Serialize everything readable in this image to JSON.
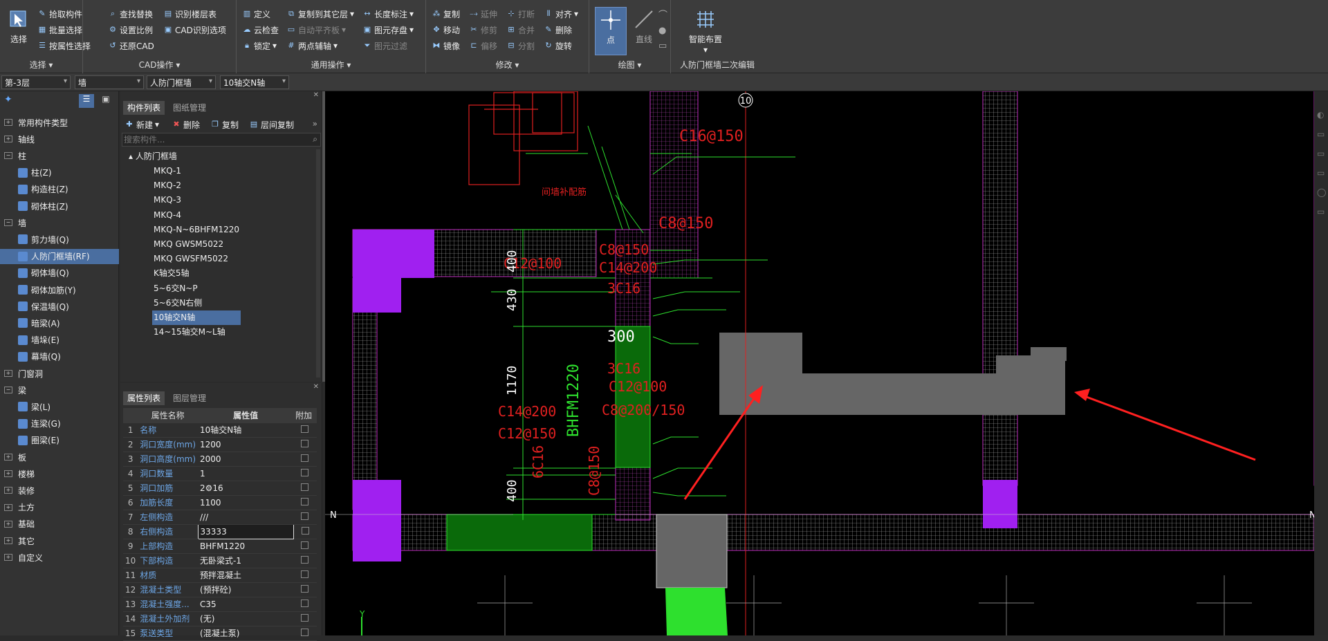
{
  "ribbon": {
    "select_label": "选择",
    "pick_component": "拾取构件",
    "batch_select": "批量选择",
    "select_by_attr": "按属性选择",
    "select_group": "选择",
    "find_replace": "查找替换",
    "set_scale": "设置比例",
    "restore_cad": "还原CAD",
    "identify_floor_table": "识别楼层表",
    "cad_identify_options": "CAD识别选项",
    "cad_ops_group": "CAD操作",
    "define": "定义",
    "cloud_check": "云检查",
    "lock": "锁定",
    "copy_to_other_floor": "复制到其它层",
    "auto_flat_slab": "自动平齐板",
    "two_point_axis": "两点辅轴",
    "length_annotation": "长度标注",
    "element_save": "图元存盘",
    "element_filter": "图元过滤",
    "general_ops_group": "通用操作",
    "copy": "复制",
    "move": "移动",
    "mirror": "镜像",
    "extend": "延伸",
    "trim": "修剪",
    "offset": "偏移",
    "break": "打断",
    "merge": "合并",
    "split": "分割",
    "align": "对齐",
    "delete": "删除",
    "rotate": "旋转",
    "modify_group": "修改",
    "point": "点",
    "line": "直线",
    "draw_group": "绘图",
    "smart_layout": "智能布置",
    "frame_wall_edit_group": "人防门框墙二次编辑"
  },
  "selector_bar": {
    "floor": "第-3层",
    "category": "墙",
    "type": "人防门框墙",
    "instance": "10轴交N轴"
  },
  "tree": {
    "items": [
      {
        "label": "常用构件类型",
        "kind": "group"
      },
      {
        "label": "轴线",
        "kind": "group"
      },
      {
        "label": "柱",
        "kind": "group-open"
      },
      {
        "label": "柱(Z)",
        "kind": "child"
      },
      {
        "label": "构造柱(Z)",
        "kind": "child"
      },
      {
        "label": "砌体柱(Z)",
        "kind": "child"
      },
      {
        "label": "墙",
        "kind": "group-open"
      },
      {
        "label": "剪力墙(Q)",
        "kind": "child"
      },
      {
        "label": "人防门框墙(RF)",
        "kind": "child-selected"
      },
      {
        "label": "砌体墙(Q)",
        "kind": "child"
      },
      {
        "label": "砌体加筋(Y)",
        "kind": "child"
      },
      {
        "label": "保温墙(Q)",
        "kind": "child"
      },
      {
        "label": "暗梁(A)",
        "kind": "child"
      },
      {
        "label": "墙垛(E)",
        "kind": "child"
      },
      {
        "label": "幕墙(Q)",
        "kind": "child"
      },
      {
        "label": "门窗洞",
        "kind": "group"
      },
      {
        "label": "梁",
        "kind": "group-open"
      },
      {
        "label": "梁(L)",
        "kind": "child"
      },
      {
        "label": "连梁(G)",
        "kind": "child"
      },
      {
        "label": "圈梁(E)",
        "kind": "child"
      },
      {
        "label": "板",
        "kind": "group"
      },
      {
        "label": "楼梯",
        "kind": "group"
      },
      {
        "label": "装修",
        "kind": "group"
      },
      {
        "label": "土方",
        "kind": "group"
      },
      {
        "label": "基础",
        "kind": "group"
      },
      {
        "label": "其它",
        "kind": "group"
      },
      {
        "label": "自定义",
        "kind": "group"
      }
    ]
  },
  "component_panel": {
    "tab_list": "构件列表",
    "tab_drawings": "图纸管理",
    "btn_new": "新建",
    "btn_delete": "删除",
    "btn_copy": "复制",
    "btn_floor_copy": "层间复制",
    "search_placeholder": "搜索构件...",
    "root": "人防门框墙",
    "items": [
      "MKQ-1",
      "MKQ-2",
      "MKQ-3",
      "MKQ-4",
      "MKQ-N~6BHFM1220",
      "MKQ GWSM5022",
      "MKQ GWSFM5022",
      "K轴交5轴",
      "5~6交N~P",
      "5~6交N右侧",
      "10轴交N轴",
      "14~15轴交M~L轴"
    ],
    "selected_index": 10
  },
  "props_panel": {
    "tab_props": "属性列表",
    "tab_layers": "图层管理",
    "col_name": "属性名称",
    "col_value": "属性值",
    "col_extra": "附加",
    "rows": [
      {
        "n": "1",
        "k": "名称",
        "v": "10轴交N轴"
      },
      {
        "n": "2",
        "k": "洞口宽度(mm)",
        "v": "1200"
      },
      {
        "n": "3",
        "k": "洞口高度(mm)",
        "v": "2000"
      },
      {
        "n": "4",
        "k": "洞口数量",
        "v": "1"
      },
      {
        "n": "5",
        "k": "洞口加筋",
        "v": "2⚙16"
      },
      {
        "n": "6",
        "k": "加筋长度",
        "v": "1100"
      },
      {
        "n": "7",
        "k": "左侧构造",
        "v": "///"
      },
      {
        "n": "8",
        "k": "右侧构造",
        "v": "33333"
      },
      {
        "n": "9",
        "k": "上部构造",
        "v": "BHFM1220"
      },
      {
        "n": "10",
        "k": "下部构造",
        "v": "无卧梁式-1"
      },
      {
        "n": "11",
        "k": "材质",
        "v": "预拌混凝土"
      },
      {
        "n": "12",
        "k": "混凝土类型",
        "v": "(预拌砼)"
      },
      {
        "n": "13",
        "k": "混凝土强度...",
        "v": "C35"
      },
      {
        "n": "14",
        "k": "混凝土外加剂",
        "v": "(无)"
      },
      {
        "n": "15",
        "k": "泵送类型",
        "v": "(混凝土泵)"
      }
    ]
  },
  "drawing": {
    "axis_10": "10",
    "axis_n_left": "N",
    "axis_n_right": "N",
    "labels": [
      "C16@150",
      "C8@150",
      "C8@150",
      "C14@200",
      "3C16",
      "3C16",
      "C12@100",
      "C12@100",
      "C8@200/150",
      "C14@200",
      "C12@150",
      "6C16",
      "C8@150",
      "BHFM1220",
      "300",
      "400",
      "430",
      "1170",
      "400",
      "间墙补配筋"
    ],
    "y_axis": "Y"
  },
  "colors": {
    "magenta": "#a020f0",
    "green_fill": "#0a6a0a",
    "bright_green": "#2ee02e",
    "red_text": "#e02020",
    "grey_block": "#666666"
  }
}
